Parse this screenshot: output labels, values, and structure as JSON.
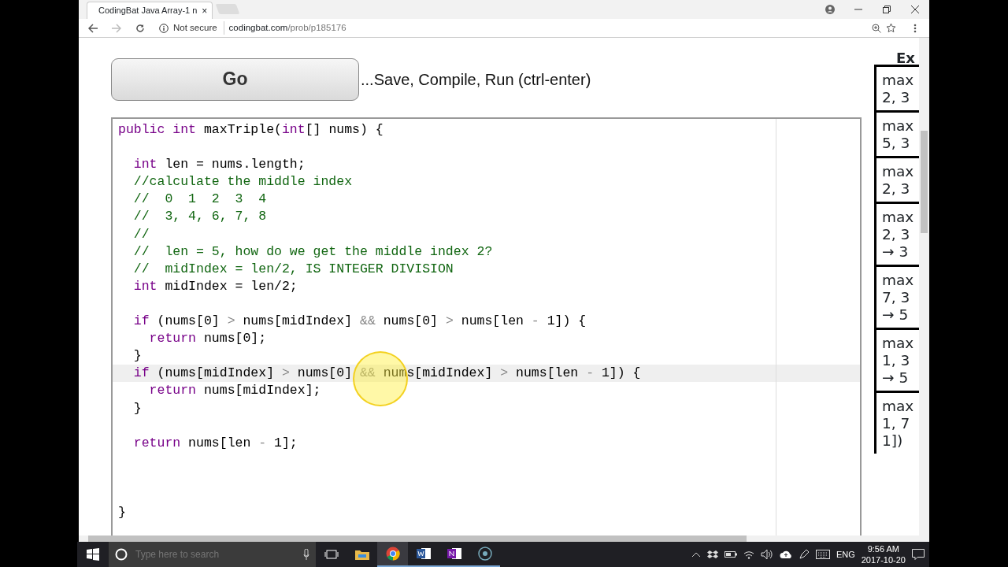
{
  "browser": {
    "tab_title": "CodingBat Java Array-1 n",
    "tab_close": "×",
    "address": {
      "security": "Not secure",
      "host": "codingbat.com",
      "path": "/prob/p185176"
    }
  },
  "go_button": "Go",
  "go_hint": "...Save, Compile, Run (ctrl-enter)",
  "editor": {
    "lines": [
      {
        "kind": "code",
        "current": false,
        "spans": [
          {
            "kind": "keyword",
            "text": "public "
          },
          {
            "kind": "keyword",
            "text": "int"
          },
          {
            "kind": "plain",
            "text": " maxTriple("
          },
          {
            "kind": "keyword",
            "text": "int"
          },
          {
            "kind": "plain",
            "text": "[] nums) {"
          }
        ]
      },
      {
        "kind": "blank"
      },
      {
        "kind": "code",
        "current": false,
        "spans": [
          {
            "kind": "keyword",
            "text": "  int"
          },
          {
            "kind": "plain",
            "text": " len = nums.length;"
          }
        ]
      },
      {
        "kind": "code",
        "current": false,
        "spans": [
          {
            "kind": "comment",
            "text": "  //calculate the middle index"
          }
        ]
      },
      {
        "kind": "code",
        "current": false,
        "spans": [
          {
            "kind": "comment",
            "text": "  //  0  1  2  3  4"
          }
        ]
      },
      {
        "kind": "code",
        "current": false,
        "spans": [
          {
            "kind": "comment",
            "text": "  //  3, 4, 6, 7, 8"
          }
        ]
      },
      {
        "kind": "code",
        "current": false,
        "spans": [
          {
            "kind": "comment",
            "text": "  //"
          }
        ]
      },
      {
        "kind": "code",
        "current": false,
        "spans": [
          {
            "kind": "comment",
            "text": "  //  len = 5, how do we get the middle index 2?"
          }
        ]
      },
      {
        "kind": "code",
        "current": false,
        "spans": [
          {
            "kind": "comment",
            "text": "  //  midIndex = len/2, IS INTEGER DIVISION"
          }
        ]
      },
      {
        "kind": "code",
        "current": false,
        "spans": [
          {
            "kind": "keyword",
            "text": "  int"
          },
          {
            "kind": "plain",
            "text": " midIndex = len/2;"
          }
        ]
      },
      {
        "kind": "blank"
      },
      {
        "kind": "code",
        "current": false,
        "spans": [
          {
            "kind": "keyword",
            "text": "  if"
          },
          {
            "kind": "plain",
            "text": " (nums[0] "
          },
          {
            "kind": "operator",
            "text": ">"
          },
          {
            "kind": "plain",
            "text": " nums[midIndex] "
          },
          {
            "kind": "operator",
            "text": "&&"
          },
          {
            "kind": "plain",
            "text": " nums[0] "
          },
          {
            "kind": "operator",
            "text": ">"
          },
          {
            "kind": "plain",
            "text": " nums[len "
          },
          {
            "kind": "operator",
            "text": "-"
          },
          {
            "kind": "plain",
            "text": " 1]) {"
          }
        ]
      },
      {
        "kind": "code",
        "current": false,
        "spans": [
          {
            "kind": "keyword",
            "text": "    return"
          },
          {
            "kind": "plain",
            "text": " nums[0];"
          }
        ]
      },
      {
        "kind": "code",
        "current": false,
        "spans": [
          {
            "kind": "plain",
            "text": "  }"
          }
        ]
      },
      {
        "kind": "code",
        "current": true,
        "spans": [
          {
            "kind": "keyword",
            "text": "  if"
          },
          {
            "kind": "plain",
            "text": " (nums[midIndex] "
          },
          {
            "kind": "operator",
            "text": ">"
          },
          {
            "kind": "plain",
            "text": " nums[0] "
          },
          {
            "kind": "operator",
            "text": "&&"
          },
          {
            "kind": "plain",
            "text": " nums[midIndex] "
          },
          {
            "kind": "operator",
            "text": ">"
          },
          {
            "kind": "plain",
            "text": " nums[len "
          },
          {
            "kind": "operator",
            "text": "-"
          },
          {
            "kind": "plain",
            "text": " 1]) {"
          }
        ]
      },
      {
        "kind": "code",
        "current": false,
        "spans": [
          {
            "kind": "keyword",
            "text": "    return"
          },
          {
            "kind": "plain",
            "text": " nums[midIndex];"
          }
        ]
      },
      {
        "kind": "code",
        "current": false,
        "spans": [
          {
            "kind": "plain",
            "text": "  }"
          }
        ]
      },
      {
        "kind": "blank"
      },
      {
        "kind": "code",
        "current": false,
        "spans": [
          {
            "kind": "keyword",
            "text": "  return"
          },
          {
            "kind": "plain",
            "text": " nums[len "
          },
          {
            "kind": "operator",
            "text": "-"
          },
          {
            "kind": "plain",
            "text": " 1];"
          }
        ]
      },
      {
        "kind": "blank"
      },
      {
        "kind": "blank"
      },
      {
        "kind": "blank"
      },
      {
        "kind": "code",
        "current": false,
        "spans": [
          {
            "kind": "plain",
            "text": "}"
          }
        ]
      }
    ]
  },
  "examples": {
    "heading": "Ex",
    "cells": [
      {
        "lines": [
          "max",
          "2, 3"
        ]
      },
      {
        "lines": [
          "max",
          "5, 3"
        ]
      },
      {
        "lines": [
          "max",
          "2, 3"
        ]
      },
      {
        "lines": [
          "max",
          "2, 3",
          "→ 3"
        ]
      },
      {
        "lines": [
          "max",
          "7, 3",
          "→ 5"
        ]
      },
      {
        "lines": [
          "max",
          "1, 3",
          "→ 5"
        ]
      },
      {
        "lines": [
          "max",
          "1, 7",
          "1])"
        ]
      }
    ]
  },
  "taskbar": {
    "search_placeholder": "Type here to search",
    "language": "ENG",
    "time": "9:56 AM",
    "date": "2017-10-20"
  }
}
